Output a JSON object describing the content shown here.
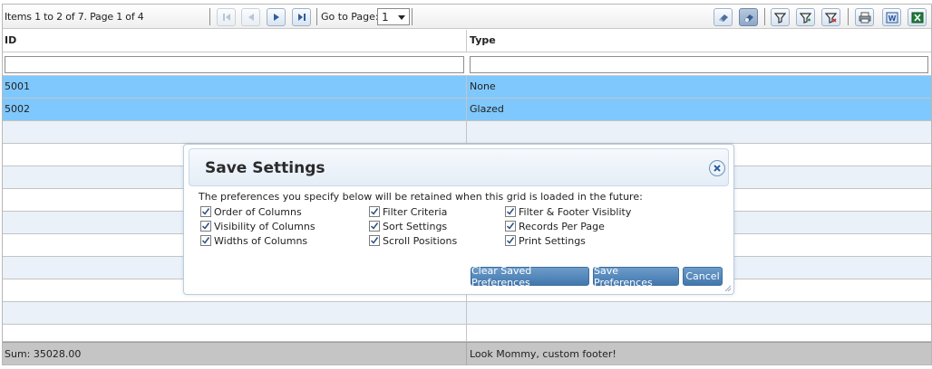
{
  "toolbar": {
    "info": "Items 1 to 2 of 7. Page 1 of 4",
    "goto_label": "Go to Page:",
    "page_value": "1",
    "buttons": {
      "first": "first-page-icon",
      "prev": "prev-page-icon",
      "next": "next-page-icon",
      "last": "last-page-icon",
      "eraser": "eraser-icon",
      "save_settings": "save-settings-icon",
      "filter": "filter-icon",
      "filter_add": "filter-add-icon",
      "filter_clear": "filter-clear-icon",
      "print": "print-icon",
      "word": "word-export-icon",
      "excel": "excel-export-icon"
    }
  },
  "grid": {
    "columns": [
      "ID",
      "Type"
    ],
    "rows": [
      {
        "id": "5001",
        "type": "None",
        "selected": true
      },
      {
        "id": "5002",
        "type": "Glazed",
        "selected": true
      }
    ],
    "footer": {
      "sum": "Sum: 35028.00",
      "type": "Look Mommy, custom footer!"
    }
  },
  "dialog": {
    "title": "Save Settings",
    "description": "The preferences you specify below will be retained when this grid is loaded in the future:",
    "options": [
      {
        "label": "Order of Columns",
        "checked": true
      },
      {
        "label": "Visibility of Columns",
        "checked": true
      },
      {
        "label": "Widths of Columns",
        "checked": true
      },
      {
        "label": "Filter Criteria",
        "checked": true
      },
      {
        "label": "Sort Settings",
        "checked": true
      },
      {
        "label": "Scroll Positions",
        "checked": true
      },
      {
        "label": "Filter & Footer Visiblity",
        "checked": true
      },
      {
        "label": "Records Per Page",
        "checked": true
      },
      {
        "label": "Print Settings",
        "checked": true
      }
    ],
    "buttons": {
      "clear": "Clear Saved Preferences",
      "save": "Save Preferences",
      "cancel": "Cancel"
    }
  },
  "colors": {
    "selected_row": "#7fc8fd",
    "alt_row": "#eaf1f9",
    "footer": "#c5c5c5",
    "button": "#4377ad"
  }
}
